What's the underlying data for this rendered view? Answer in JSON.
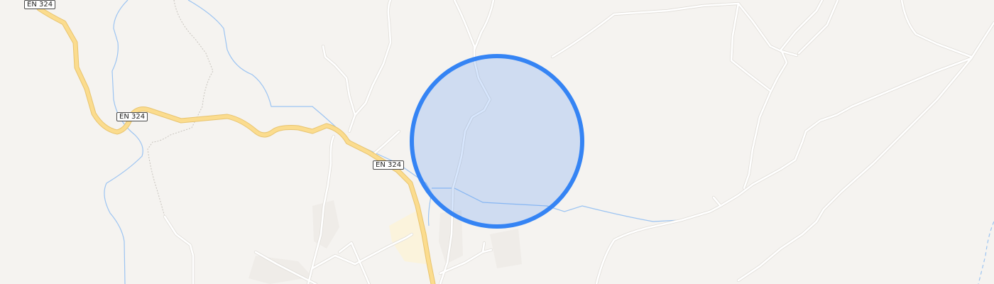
{
  "map": {
    "road_labels": [
      "EN 324",
      "EN 324",
      "EN 324"
    ],
    "colors": {
      "land": "#f5f3f0",
      "minor_road": "#ffffff",
      "primary_road": "#fbdc8e",
      "primary_road_casing": "#e8c46f",
      "water": "#9cc4f2",
      "settlement": "#fbf3dc",
      "track": "#c8c4be",
      "location_fill": "#3584f4",
      "location_stroke": "#3584f4"
    },
    "location_marker": {
      "shape": "circle",
      "fill_opacity": 0.2
    }
  }
}
